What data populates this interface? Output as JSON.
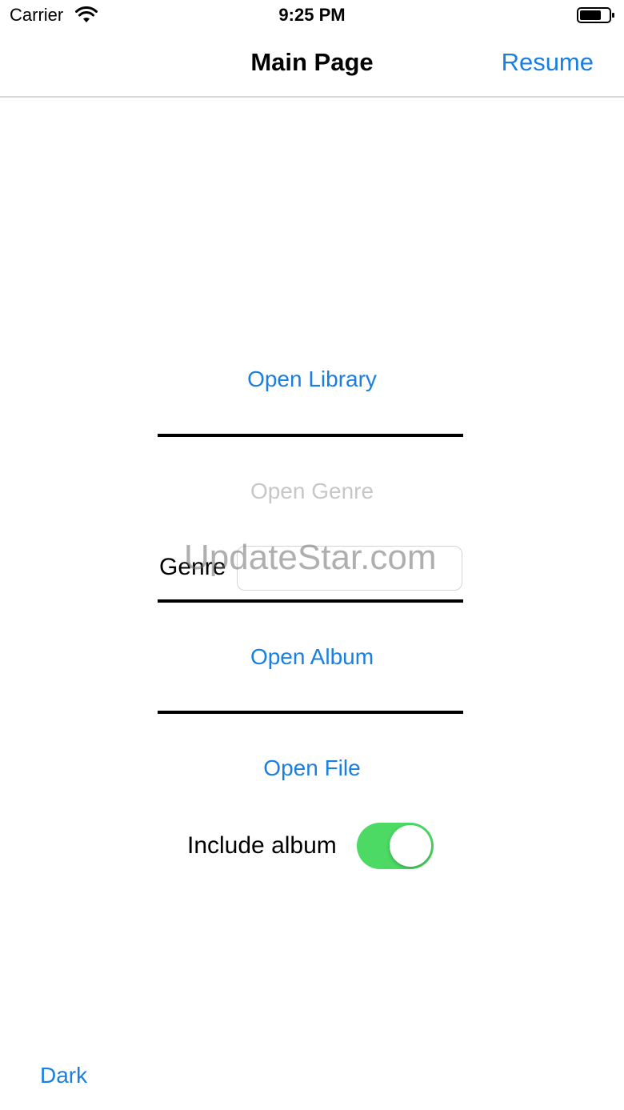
{
  "status_bar": {
    "carrier": "Carrier",
    "time": "9:25 PM"
  },
  "nav": {
    "title": "Main Page",
    "resume_label": "Resume"
  },
  "buttons": {
    "open_library": "Open Library",
    "open_genre": "Open Genre",
    "open_album": "Open Album",
    "open_file": "Open File",
    "dark": "Dark"
  },
  "genre": {
    "label": "Genre",
    "value": "",
    "placeholder": ""
  },
  "watermark": "UpdateStar.com",
  "include_album": {
    "label": "Include album",
    "on": true
  },
  "colors": {
    "accent": "#1a7fe0",
    "toggle_on": "#4cd964",
    "disabled": "#c7c7c7"
  }
}
